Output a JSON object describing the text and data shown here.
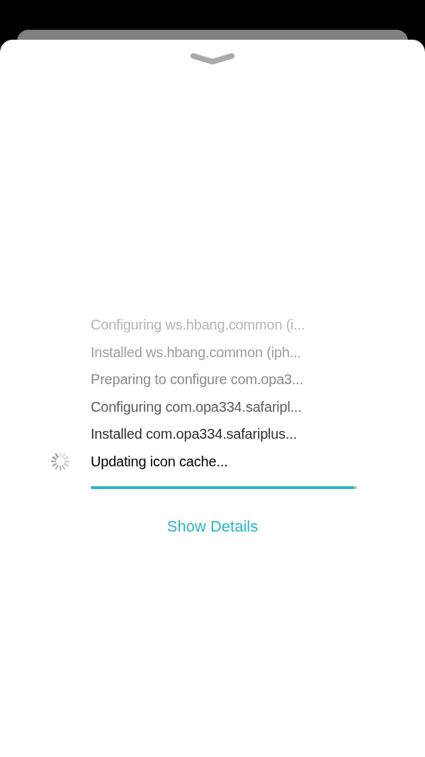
{
  "log_lines": [
    {
      "text": "Configuring ws.hbang.common (i...",
      "color": "#b5b5b5"
    },
    {
      "text": "Installed ws.hbang.common (iph...",
      "color": "#9d9d9d"
    },
    {
      "text": "Preparing to configure com.opa3...",
      "color": "#8a8a8a"
    },
    {
      "text": "Configuring com.opa334.safaripl...",
      "color": "#5c5c5c"
    },
    {
      "text": "Installed com.opa334.safariplus...",
      "color": "#2e2e2e"
    },
    {
      "text": "Updating icon cache...",
      "color": "#000000"
    }
  ],
  "progress": {
    "level": 0.99
  },
  "show_details_link": "Show Details"
}
